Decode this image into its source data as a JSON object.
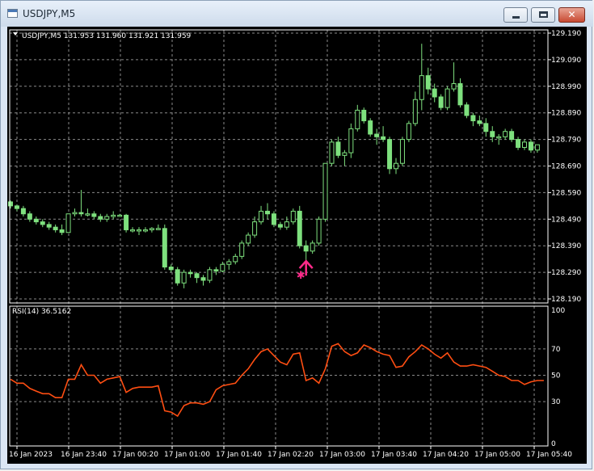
{
  "window": {
    "title": "USDJPY,M5",
    "icon": "chart-window-icon",
    "controls": {
      "minimize": "minimize-icon",
      "maximize": "maximize-icon",
      "close": "close-icon"
    }
  },
  "price_panel": {
    "info": "USDJPY,M5  131.953 131.960 131.921 131.959",
    "price_ticks": [
      "129.190",
      "129.090",
      "128.990",
      "128.890",
      "128.790",
      "128.690",
      "128.590",
      "128.490",
      "128.390",
      "128.290",
      "128.190"
    ]
  },
  "rsi_panel": {
    "info": "RSI(14) 36.5162",
    "ticks": [
      "100",
      "70",
      "50",
      "30",
      "0"
    ]
  },
  "time_ticks": [
    "16 Jan 2023",
    "16 Jan 23:40",
    "17 Jan 00:20",
    "17 Jan 01:00",
    "17 Jan 01:40",
    "17 Jan 02:20",
    "17 Jan 03:00",
    "17 Jan 03:40",
    "17 Jan 04:20",
    "17 Jan 05:00",
    "17 Jan 05:40"
  ],
  "colors": {
    "background": "#000000",
    "candle": "#7ee07e",
    "rsi_line": "#ff4e12",
    "signal": "#ff2a8a",
    "grid": "#8a8a8a",
    "text": "#ffffff"
  },
  "chart_data": {
    "type": "candlestick",
    "price_axis_range": [
      128.19,
      129.19
    ],
    "candles": [
      [
        128.555,
        128.56,
        128.53,
        128.54
      ],
      [
        128.54,
        128.545,
        128.52,
        128.53
      ],
      [
        128.53,
        128.54,
        128.5,
        128.51
      ],
      [
        128.51,
        128.52,
        128.48,
        128.49
      ],
      [
        128.49,
        128.5,
        128.47,
        128.48
      ],
      [
        128.48,
        128.49,
        128.46,
        128.47
      ],
      [
        128.47,
        128.48,
        128.45,
        128.46
      ],
      [
        128.46,
        128.47,
        128.44,
        128.45
      ],
      [
        128.45,
        128.47,
        128.43,
        128.44
      ],
      [
        128.44,
        128.51,
        128.44,
        128.51
      ],
      [
        128.51,
        128.53,
        128.5,
        128.515
      ],
      [
        128.515,
        128.6,
        128.5,
        128.51
      ],
      [
        128.51,
        128.53,
        128.5,
        128.51
      ],
      [
        128.51,
        128.52,
        128.49,
        128.5
      ],
      [
        128.5,
        128.51,
        128.48,
        128.49
      ],
      [
        128.49,
        128.51,
        128.48,
        128.5
      ],
      [
        128.5,
        128.52,
        128.49,
        128.505
      ],
      [
        128.505,
        128.51,
        128.5,
        128.505
      ],
      [
        128.505,
        128.51,
        128.44,
        128.45
      ],
      [
        128.45,
        128.46,
        128.44,
        128.45
      ],
      [
        128.45,
        128.46,
        128.43,
        128.45
      ],
      [
        128.45,
        128.46,
        128.44,
        128.45
      ],
      [
        128.45,
        128.46,
        128.44,
        128.455
      ],
      [
        128.455,
        128.47,
        128.45,
        128.455
      ],
      [
        128.455,
        128.47,
        128.3,
        128.31
      ],
      [
        128.31,
        128.32,
        128.29,
        128.3
      ],
      [
        128.3,
        128.31,
        128.24,
        128.25
      ],
      [
        128.25,
        128.3,
        128.23,
        128.29
      ],
      [
        128.29,
        128.3,
        128.27,
        128.285
      ],
      [
        128.285,
        128.29,
        128.25,
        128.27
      ],
      [
        128.27,
        128.28,
        128.24,
        128.26
      ],
      [
        128.26,
        128.31,
        128.25,
        128.3
      ],
      [
        128.3,
        128.31,
        128.28,
        128.295
      ],
      [
        128.295,
        128.33,
        128.29,
        128.32
      ],
      [
        128.32,
        128.34,
        128.3,
        128.33
      ],
      [
        128.33,
        128.36,
        128.32,
        128.35
      ],
      [
        128.35,
        128.41,
        128.34,
        128.4
      ],
      [
        128.4,
        128.44,
        128.39,
        128.43
      ],
      [
        128.43,
        128.5,
        128.42,
        128.48
      ],
      [
        128.48,
        128.54,
        128.47,
        128.52
      ],
      [
        128.52,
        128.55,
        128.49,
        128.51
      ],
      [
        128.51,
        128.52,
        128.46,
        128.47
      ],
      [
        128.47,
        128.48,
        128.45,
        128.46
      ],
      [
        128.46,
        128.5,
        128.45,
        128.48
      ],
      [
        128.48,
        128.53,
        128.47,
        128.52
      ],
      [
        128.52,
        128.54,
        128.38,
        128.39
      ],
      [
        128.39,
        128.41,
        128.32,
        128.37
      ],
      [
        128.37,
        128.41,
        128.36,
        128.4
      ],
      [
        128.4,
        128.5,
        128.39,
        128.49
      ],
      [
        128.49,
        128.7,
        128.48,
        128.7
      ],
      [
        128.7,
        128.79,
        128.69,
        128.78
      ],
      [
        128.78,
        128.8,
        128.72,
        128.73
      ],
      [
        128.73,
        128.75,
        128.69,
        128.74
      ],
      [
        128.74,
        128.85,
        128.72,
        128.83
      ],
      [
        128.83,
        128.92,
        128.82,
        128.9
      ],
      [
        128.9,
        128.91,
        128.85,
        128.86
      ],
      [
        128.86,
        128.87,
        128.8,
        128.81
      ],
      [
        128.81,
        128.83,
        128.77,
        128.8
      ],
      [
        128.8,
        128.84,
        128.78,
        128.79
      ],
      [
        128.79,
        128.8,
        128.66,
        128.68
      ],
      [
        128.68,
        128.72,
        128.66,
        128.7
      ],
      [
        128.7,
        128.8,
        128.69,
        128.79
      ],
      [
        128.79,
        128.86,
        128.78,
        128.85
      ],
      [
        128.85,
        128.97,
        128.84,
        128.94
      ],
      [
        128.94,
        129.15,
        128.9,
        129.03
      ],
      [
        129.03,
        129.06,
        128.96,
        128.98
      ],
      [
        128.98,
        129.0,
        128.93,
        128.95
      ],
      [
        128.95,
        128.96,
        128.9,
        128.91
      ],
      [
        128.91,
        128.99,
        128.9,
        128.98
      ],
      [
        128.98,
        129.08,
        128.97,
        129.0
      ],
      [
        129.0,
        129.02,
        128.91,
        128.92
      ],
      [
        128.92,
        128.93,
        128.87,
        128.88
      ],
      [
        128.88,
        128.89,
        128.84,
        128.86
      ],
      [
        128.86,
        128.88,
        128.84,
        128.85
      ],
      [
        128.85,
        128.87,
        128.8,
        128.82
      ],
      [
        128.82,
        128.84,
        128.78,
        128.8
      ],
      [
        128.8,
        128.81,
        128.77,
        128.8
      ],
      [
        128.8,
        128.83,
        128.79,
        128.82
      ],
      [
        128.82,
        128.83,
        128.78,
        128.79
      ],
      [
        128.79,
        128.8,
        128.75,
        128.76
      ],
      [
        128.76,
        128.79,
        128.75,
        128.78
      ],
      [
        128.78,
        128.79,
        128.74,
        128.75
      ],
      [
        128.75,
        128.77,
        128.74,
        128.77
      ]
    ],
    "rsi_axis_range": [
      0,
      100
    ],
    "rsi": [
      47,
      44,
      44,
      40,
      38,
      36,
      36,
      33,
      33,
      47,
      47,
      58,
      50,
      50,
      44,
      47,
      48,
      49,
      37,
      40,
      41,
      41,
      41,
      42,
      23,
      22,
      19,
      27,
      29,
      29,
      28,
      30,
      39,
      42,
      43,
      44,
      50,
      55,
      62,
      68,
      70,
      65,
      60,
      58,
      66,
      67,
      46,
      48,
      44,
      55,
      72,
      74,
      68,
      65,
      67,
      73,
      71,
      68,
      66,
      65,
      56,
      57,
      64,
      68,
      73,
      70,
      66,
      63,
      67,
      60,
      57,
      57,
      58,
      57,
      56,
      53,
      50,
      49,
      46,
      46,
      43,
      45,
      46,
      46
    ],
    "signal": {
      "candle_index": 46,
      "price": 128.29,
      "type": "buy-arrow"
    }
  }
}
